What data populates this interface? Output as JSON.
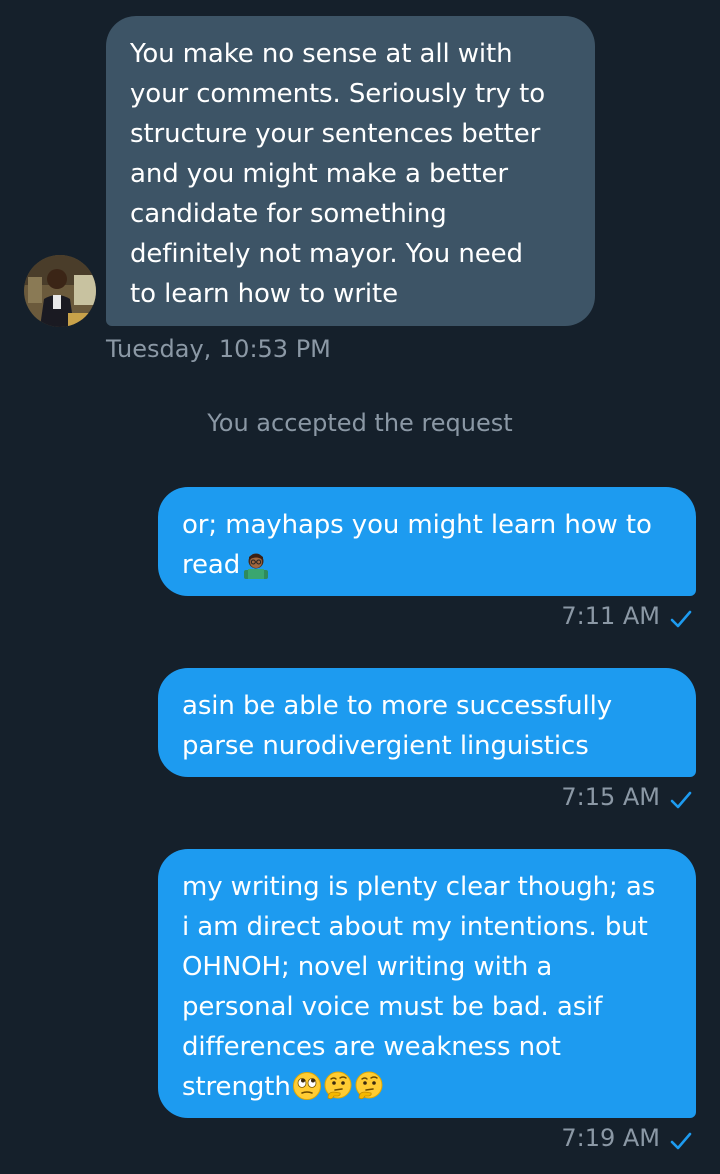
{
  "conversation": {
    "incoming": {
      "lines": [
        "You make no sense at all with",
        "your comments. Seriously try to",
        "structure your sentences better",
        "and you might make a better",
        "candidate for something",
        "definitely not mayor. You need",
        "to learn how to write"
      ],
      "timestamp": "Tuesday, 10:53 PM"
    },
    "system_notice": "You accepted the request",
    "outgoing": [
      {
        "lines": [
          "or; mayhaps you might learn how to",
          "read"
        ],
        "emojis": [
          "woman-teacher-emoji"
        ],
        "time": "7:11 AM"
      },
      {
        "lines": [
          "asin be able to more successfully",
          "parse nurodivergient linguistics"
        ],
        "time": "7:15 AM"
      },
      {
        "lines": [
          "my writing is plenty clear though; as",
          "i am direct about my intentions. but",
          "OHNOH; novel writing with a",
          "personal voice must be bad. asif",
          "differences are weakness not",
          "strength"
        ],
        "emojis": [
          "face-with-rolling-eyes-emoji",
          "thinking-face-emoji",
          "thinking-face-emoji"
        ],
        "time": "7:19 AM"
      }
    ]
  },
  "colors": {
    "background": "#15202b",
    "incoming_bubble": "#3d5466",
    "outgoing_bubble": "#1d9bf0",
    "meta_text": "#8b98a5",
    "read_check": "#1d9bf0"
  }
}
